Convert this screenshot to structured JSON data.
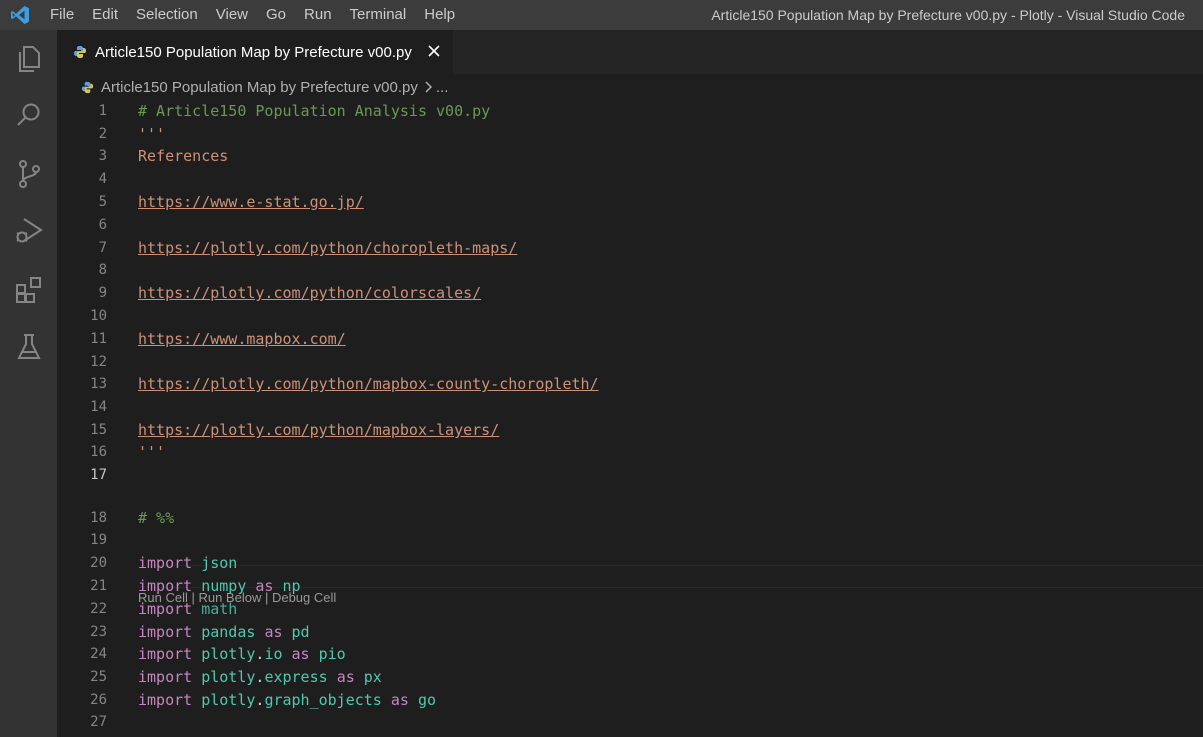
{
  "menu": [
    "File",
    "Edit",
    "Selection",
    "View",
    "Go",
    "Run",
    "Terminal",
    "Help"
  ],
  "window_title": "Article150 Population Map by Prefecture v00.py - Plotly - Visual Studio Code",
  "activity_icons": [
    "explorer-icon",
    "search-icon",
    "source-control-icon",
    "run-debug-icon",
    "extensions-icon",
    "testing-icon"
  ],
  "tab": {
    "label": "Article150 Population Map by Prefecture v00.py",
    "close": "✕"
  },
  "breadcrumb": {
    "file": "Article150 Population Map by Prefecture v00.py",
    "more": "..."
  },
  "colors": {
    "comment": "#6a9955",
    "string": "#ce9178",
    "keyword": "#c586c0",
    "module": "#4ec9b0",
    "linenumber": "#858585"
  },
  "codelens": {
    "run_cell": "Run Cell",
    "run_below": "Run Below",
    "debug_cell": "Debug Cell",
    "separator": " | "
  },
  "code": {
    "l1": "# Article150 Population Analysis v00.py",
    "l2": "'''",
    "l3": "References",
    "l5": "https://www.e-stat.go.jp/",
    "l7": "https://plotly.com/python/choropleth-maps/",
    "l9": "https://plotly.com/python/colorscales/",
    "l11": "https://www.mapbox.com/",
    "l13": "https://plotly.com/python/mapbox-county-choropleth/",
    "l15": "https://plotly.com/python/mapbox-layers/",
    "l16": "'''",
    "l18": "# %%",
    "import_kw": "import",
    "as_kw": "as",
    "dot": ".",
    "json": "json",
    "numpy": "numpy",
    "np": "np",
    "math": "math",
    "pandas": "pandas",
    "pd": "pd",
    "plotly": "plotly",
    "io": "io",
    "pio": "pio",
    "express": "express",
    "px": "px",
    "graph_objects": "graph_objects",
    "go": "go"
  },
  "line_numbers": [
    "1",
    "2",
    "3",
    "4",
    "5",
    "6",
    "7",
    "8",
    "9",
    "10",
    "11",
    "12",
    "13",
    "14",
    "15",
    "16",
    "17",
    "18",
    "19",
    "20",
    "21",
    "22",
    "23",
    "24",
    "25",
    "26",
    "27"
  ]
}
